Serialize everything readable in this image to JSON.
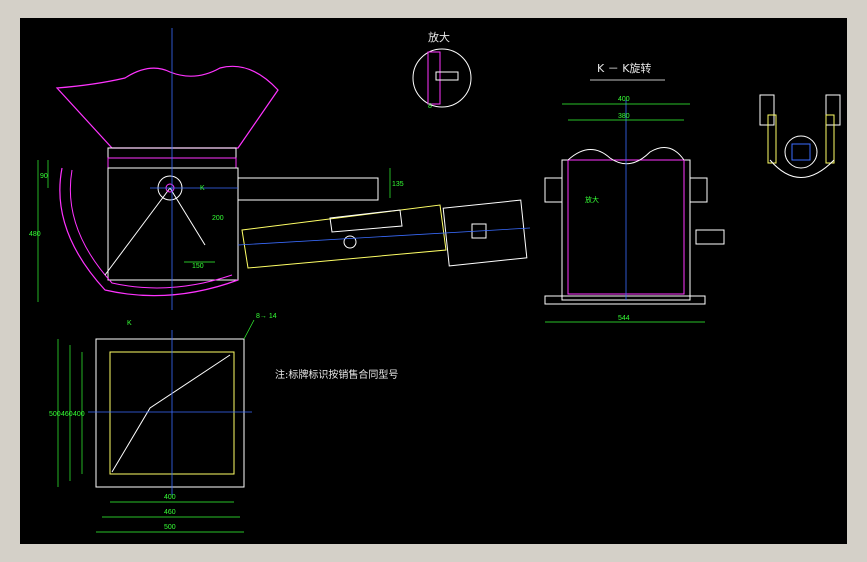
{
  "drawing": {
    "detail_label": "放大",
    "section_label": "K － K旋转",
    "note": "注:标牌标识按销售合同型号",
    "callout_label": "放大",
    "view_marker": "K",
    "view_marker_bottom": "K",
    "dims": {
      "d90": "90",
      "d480": "480",
      "d135": "135",
      "d200": "200",
      "d150": "150",
      "d8": "8",
      "d400_top": "400",
      "d380": "380",
      "d544": "544",
      "d8_14": "8→ 14",
      "d500_left": "500",
      "d460_left": "460",
      "d400_left": "400",
      "d400_bottom": "400",
      "d460_bottom": "460",
      "d500_bottom": "500"
    }
  },
  "colors": {
    "background": "#000000",
    "outline": "#ffffff",
    "hopper": "#ff33ff",
    "centerline": "#3a6cff",
    "dimension": "#35ff35",
    "flange": "#ffff66",
    "cylinder": "#ffff66"
  }
}
